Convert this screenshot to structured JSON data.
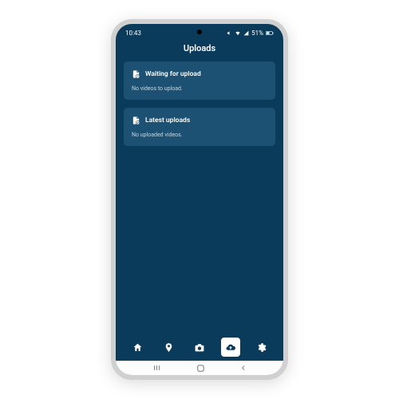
{
  "status": {
    "time": "10:43",
    "battery": "51%"
  },
  "header": {
    "title": "Uploads"
  },
  "cards": {
    "waiting": {
      "title": "Waiting for upload",
      "subtitle": "No videos to upload."
    },
    "latest": {
      "title": "Latest uploads",
      "subtitle": "No uploaded videos."
    }
  }
}
